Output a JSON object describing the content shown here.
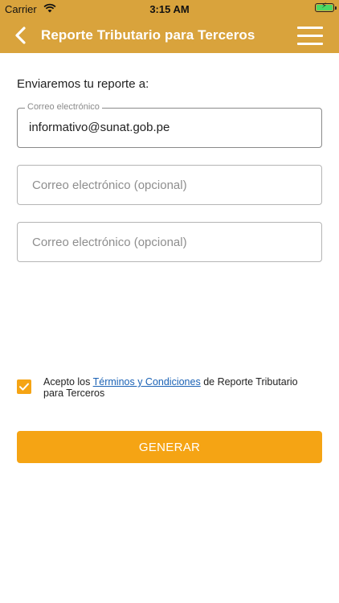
{
  "status_bar": {
    "carrier": "Carrier",
    "time": "3:15 AM",
    "battery_icon": "battery-charging-icon",
    "wifi_icon": "wifi-icon"
  },
  "nav_bar": {
    "title": "Reporte Tributario para Terceros",
    "back_icon": "chevron-left-icon",
    "menu_icon": "hamburger-menu-icon",
    "background_color": "#d9a33c"
  },
  "form": {
    "intro": "Enviaremos tu reporte a:",
    "email_1": {
      "label": "Correo electrónico",
      "value": "informativo@sunat.gob.pe"
    },
    "email_2": {
      "placeholder": "Correo electrónico (opcional)",
      "value": ""
    },
    "email_3": {
      "placeholder": "Correo electrónico (opcional)",
      "value": ""
    }
  },
  "terms": {
    "checked": true,
    "prefix": "Acepto los ",
    "link": "Términos y Condiciones",
    "suffix": " de Reporte Tributario para Terceros"
  },
  "actions": {
    "generate_label": "GENERAR",
    "accent_color": "#f5a414"
  }
}
